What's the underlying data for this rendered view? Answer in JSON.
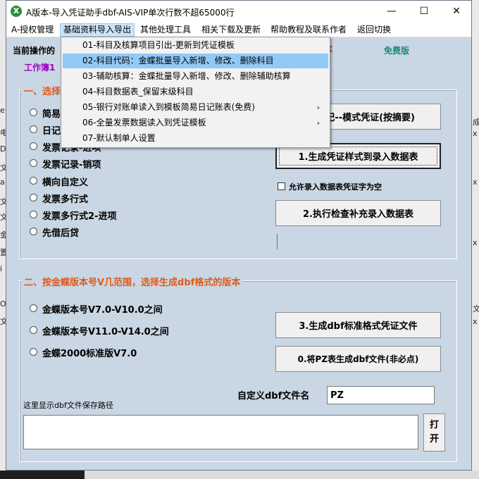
{
  "window": {
    "title": "A版本-导入凭证助手dbf-AIS-VIP单次行数不超65000行",
    "app_icon": "X",
    "controls": {
      "minimize": "—",
      "maximize": "☐",
      "close": "✕"
    }
  },
  "menubar": {
    "items": [
      "A-授权管理",
      "基础资料导入导出",
      "其他处理工具",
      "相关下载及更新",
      "帮助教程及联系作者",
      "返回切换"
    ]
  },
  "dropdown": {
    "items": [
      {
        "label": "01-科目及核算项目引出-更新到凭证模板",
        "submenu": false
      },
      {
        "label": "02-科目代码：金蝶批量导入新增、修改、删除科目",
        "submenu": false
      },
      {
        "label": "03-辅助核算：金蝶批量导入新增、修改、删除辅助核算",
        "submenu": false
      },
      {
        "label": "04-科目数据表_保留末级科目",
        "submenu": false
      },
      {
        "label": "05-银行对账单读入到模板简易日记账表(免费)",
        "submenu": true
      },
      {
        "label": "06-全量发票数据读入到凭证模板",
        "submenu": true
      },
      {
        "label": "07-默认制单人设置",
        "submenu": false
      }
    ],
    "arrow": "›"
  },
  "header": {
    "current_op_label": "当前操作的",
    "workbook_label": "工作簿1",
    "free_label": "免费版",
    "red_mark": "X"
  },
  "section1": {
    "title": "一、选择",
    "options": [
      "简易",
      "日记",
      "发票记录-进项",
      "发票记录-销项",
      "横向自定义",
      "发票多行式",
      "发票多行式2-进项",
      "先借后贷"
    ],
    "btn_template": "记--模式凭证(按摘要)",
    "btn_generate": "1.生成凭证样式到录入数据表",
    "checkbox_label": "允许录入数据表凭证字为空",
    "btn_check": "2.执行检查补充录入数据表"
  },
  "section2": {
    "title": "二、按金蝶版本号V几范围，选择生成dbf格式的版本",
    "options": [
      "金蝶版本号V7.0-V10.0之间",
      "金蝶版本号V11.0-V14.0之间",
      "金蝶2000标准版V7.0"
    ],
    "btn_dbf": "3.生成dbf标准格式凭证文件",
    "btn_pz": "0.将PZ表生成dbf文件(非必点)",
    "filename_label": "自定义dbf文件名",
    "filename_value": "PZ",
    "path_hint": "这里显示dbf文件保存路径",
    "open_btn": "打开"
  },
  "edge_text": {
    "left": [
      "e",
      "电",
      "D",
      "文",
      "a",
      "l",
      "文",
      "文",
      "金",
      "置",
      "i",
      "O",
      "文"
    ],
    "right": [
      "成",
      "x",
      "x",
      "x",
      "文",
      "x"
    ]
  }
}
